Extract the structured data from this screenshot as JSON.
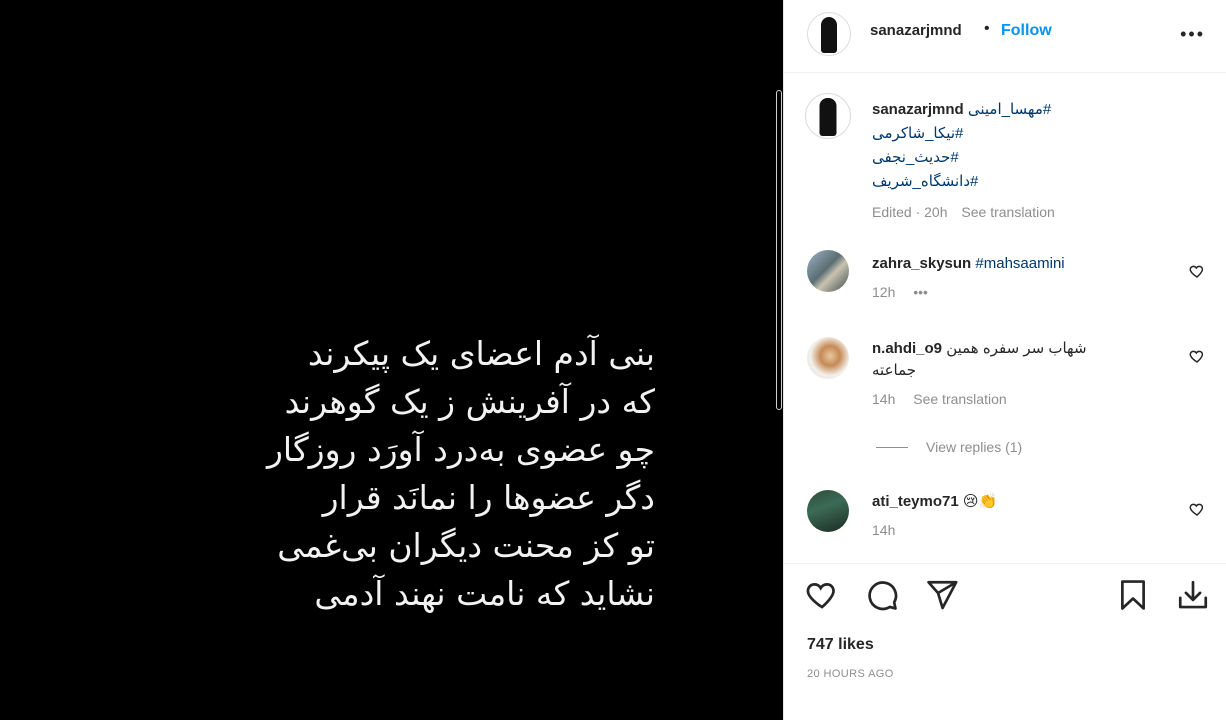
{
  "post": {
    "poem_lines": [
      "بنی آدم اعضای یک پیکرند",
      "که در آفرینش ز یک گوهرند",
      "چو عضوی به‌درد آورَد روزگار",
      "دگر عضوها را نمانَد قرار",
      "تو کز محنت دیگران بی‌غمی",
      "نشاید که نامت نهند آدمی"
    ]
  },
  "header": {
    "username": "sanazarjmnd",
    "separator": "•",
    "follow_label": "Follow",
    "more_label": "•••"
  },
  "caption": {
    "username": "sanazarjmnd",
    "hashtags": [
      "#مهسا_امینی",
      "#نیکا_شاکرمی",
      "#حدیث_نجفی",
      "#دانشگاه_شریف"
    ],
    "meta_time": "Edited · 20h",
    "see_translation": "See translation"
  },
  "comments": [
    {
      "username": "zahra_skysun",
      "text": "#mahsaamini",
      "time": "12h",
      "extra": "•••"
    },
    {
      "username": "n.ahdi_o9",
      "text_line1": "شهاب سر سفره همین",
      "text_line2": "جماعته",
      "time": "14h",
      "see_translation": "See translation"
    },
    {
      "username": "ati_teymo71",
      "text": "😢👏",
      "time": "14h"
    }
  ],
  "view_replies_label": "View replies (1)",
  "likes_label": "747 likes",
  "timestamp_label": "20 HOURS AGO",
  "icons": {
    "like": "heart-icon",
    "comment": "comment-icon",
    "share": "paper-plane-icon",
    "save": "bookmark-icon",
    "download": "download-icon"
  }
}
